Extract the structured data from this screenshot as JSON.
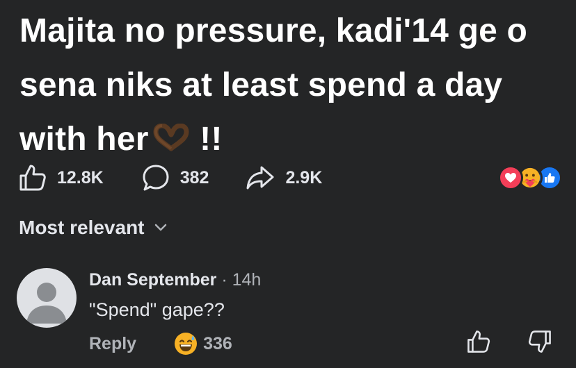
{
  "post": {
    "text": "Majita no pressure, kadi'14 ge o sena niks at least spend a day with her",
    "text_suffix": "!!",
    "text_emoji": "heart-hands-emoji"
  },
  "actions": {
    "like_count": "12.8K",
    "comment_count": "382",
    "share_count": "2.9K"
  },
  "reactions": [
    "love-reaction-icon",
    "care-reaction-icon",
    "like-reaction-icon"
  ],
  "sort": {
    "label": "Most relevant"
  },
  "comment": {
    "author": "Dan September",
    "separator": "·",
    "time": "14h",
    "text": "\"Spend\" gape??",
    "reply_label": "Reply",
    "reaction_emoji": "grinning-sweat-emoji",
    "reaction_count": "336"
  },
  "colors": {
    "background": "#242526",
    "text_primary": "#e4e6eb",
    "text_secondary": "#b0b3b8",
    "love": "#f33e58",
    "like": "#1877f2"
  }
}
